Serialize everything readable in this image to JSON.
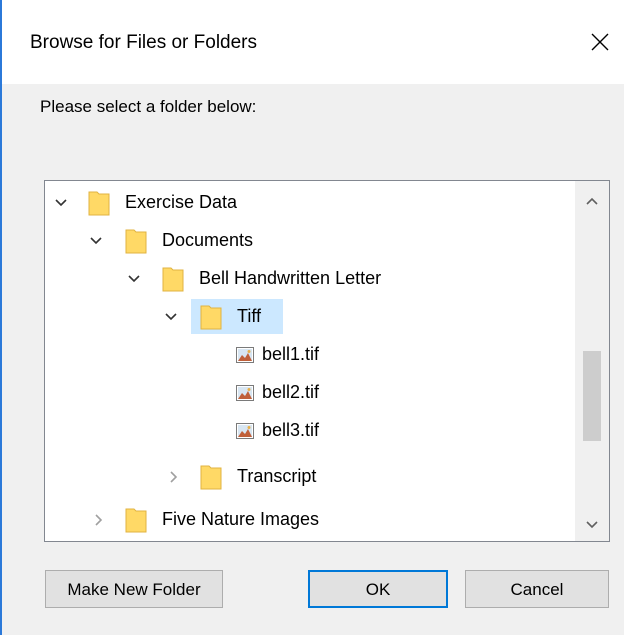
{
  "dialog": {
    "title": "Browse for Files or Folders",
    "prompt": "Please select a folder below:"
  },
  "tree": {
    "items": [
      {
        "label": "Exercise Data",
        "type": "folder",
        "expanded": true
      },
      {
        "label": "Documents",
        "type": "folder",
        "expanded": true
      },
      {
        "label": "Bell Handwritten Letter",
        "type": "folder",
        "expanded": true
      },
      {
        "label": "Tiff",
        "type": "folder",
        "expanded": true,
        "selected": true
      },
      {
        "label": "bell1.tif",
        "type": "file"
      },
      {
        "label": "bell2.tif",
        "type": "file"
      },
      {
        "label": "bell3.tif",
        "type": "file"
      },
      {
        "label": "Transcript",
        "type": "folder",
        "expanded": false
      },
      {
        "label": "Five Nature Images",
        "type": "folder",
        "expanded": false
      }
    ]
  },
  "buttons": {
    "make_new_folder": "Make New Folder",
    "ok": "OK",
    "cancel": "Cancel"
  },
  "colors": {
    "selection": "#cce8ff",
    "folder": "#ffd966",
    "accent": "#0078d7"
  }
}
